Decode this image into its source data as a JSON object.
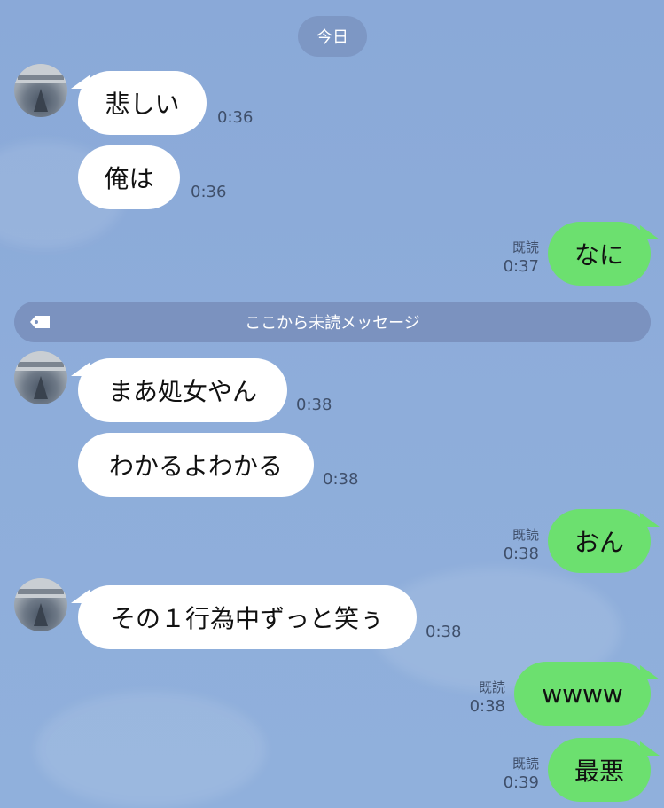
{
  "date_label": "今日",
  "unread_divider": "ここから未読メッセージ",
  "messages": [
    {
      "side": "left",
      "text": "悲しい",
      "time": "0:36"
    },
    {
      "side": "left",
      "text": "俺は",
      "time": "0:36"
    },
    {
      "side": "right",
      "text": "なに",
      "read": "既読",
      "time": "0:37"
    },
    {
      "side": "left",
      "text": "まあ処女やん",
      "time": "0:38"
    },
    {
      "side": "left",
      "text": "わかるよわかる",
      "time": "0:38"
    },
    {
      "side": "right",
      "text": "おん",
      "read": "既読",
      "time": "0:38"
    },
    {
      "side": "left",
      "text": "その１行為中ずっと笑ぅ",
      "time": "0:38"
    },
    {
      "side": "right",
      "text": "wwww",
      "read": "既読",
      "time": "0:38"
    },
    {
      "side": "right",
      "text": "最悪",
      "read": "既読",
      "time": "0:39"
    }
  ],
  "colors": {
    "background": "#8eadda",
    "my_bubble": "#6ce06f",
    "their_bubble": "#ffffff"
  }
}
